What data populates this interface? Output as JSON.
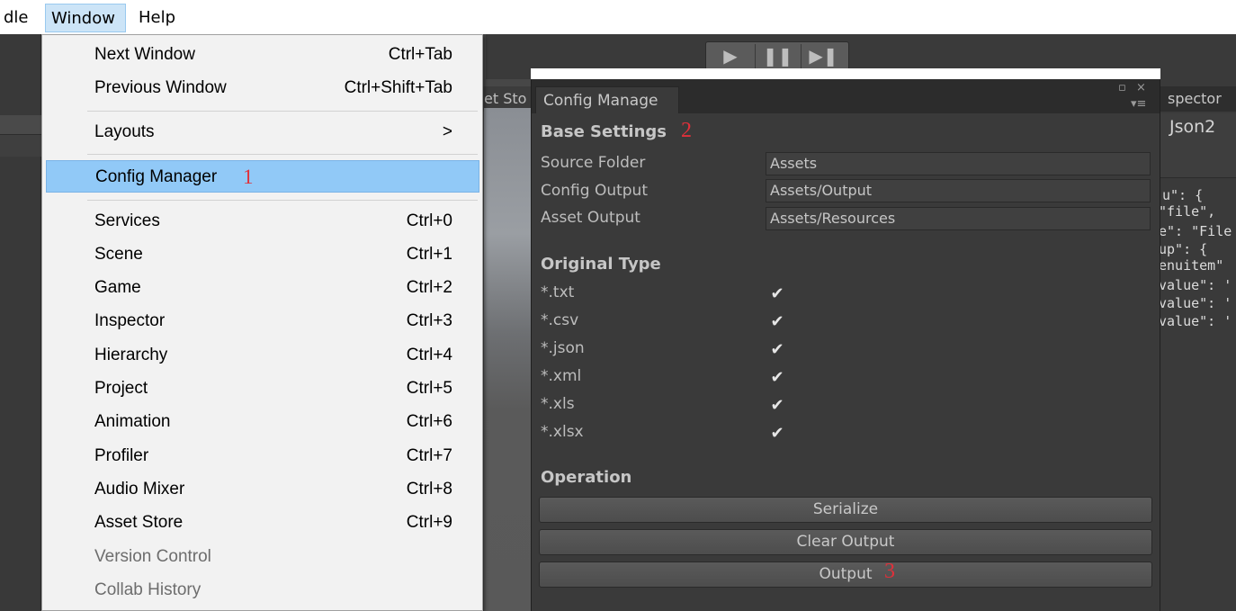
{
  "menubar": {
    "items": [
      "dle",
      "Window",
      "Help"
    ]
  },
  "window_menu": {
    "items": [
      {
        "label": "Next Window",
        "shortcut": "Ctrl+Tab"
      },
      {
        "label": "Previous Window",
        "shortcut": "Ctrl+Shift+Tab"
      },
      {
        "label": "Layouts",
        "shortcut": ">"
      },
      {
        "label": "Config Manager",
        "shortcut": "",
        "marker": "1"
      },
      {
        "label": "Services",
        "shortcut": "Ctrl+0"
      },
      {
        "label": "Scene",
        "shortcut": "Ctrl+1"
      },
      {
        "label": "Game",
        "shortcut": "Ctrl+2"
      },
      {
        "label": "Inspector",
        "shortcut": "Ctrl+3"
      },
      {
        "label": "Hierarchy",
        "shortcut": "Ctrl+4"
      },
      {
        "label": "Project",
        "shortcut": "Ctrl+5"
      },
      {
        "label": "Animation",
        "shortcut": "Ctrl+6"
      },
      {
        "label": "Profiler",
        "shortcut": "Ctrl+7"
      },
      {
        "label": "Audio Mixer",
        "shortcut": "Ctrl+8"
      },
      {
        "label": "Asset Store",
        "shortcut": "Ctrl+9"
      },
      {
        "label": "Version Control",
        "shortcut": ""
      },
      {
        "label": "Collab History",
        "shortcut": ""
      }
    ]
  },
  "editor": {
    "play_icons": [
      "▶",
      "❚❚",
      "▶❚"
    ],
    "asset_store_tab": "et Sto",
    "inspector_tab": "spector",
    "inspector_title": "Json2",
    "json_lines": [
      "u\": {",
      "\"file\",",
      "e\": \"File",
      "up\": {",
      "enuitem\"",
      "value\": '",
      "value\": '",
      "value\": '"
    ]
  },
  "config_manager": {
    "tab_title": "Config Manage",
    "window_controls": [
      "▫",
      "×",
      "▾≡"
    ],
    "base_settings": {
      "heading": "Base Settings",
      "marker": "2",
      "fields": [
        {
          "label": "Source Folder",
          "value": "Assets"
        },
        {
          "label": "Config Output",
          "value": "Assets/Output"
        },
        {
          "label": "Asset Output",
          "value": "Assets/Resources"
        }
      ]
    },
    "original_type": {
      "heading": "Original Type",
      "types": [
        {
          "label": "*.txt",
          "checked": true
        },
        {
          "label": "*.csv",
          "checked": true
        },
        {
          "label": "*.json",
          "checked": true
        },
        {
          "label": "*.xml",
          "checked": true
        },
        {
          "label": "*.xls",
          "checked": true
        },
        {
          "label": "*.xlsx",
          "checked": true
        }
      ],
      "check_glyph": "✔"
    },
    "operation": {
      "heading": "Operation",
      "buttons": [
        "Serialize",
        "Clear Output",
        "Output"
      ],
      "output_marker": "3"
    }
  }
}
